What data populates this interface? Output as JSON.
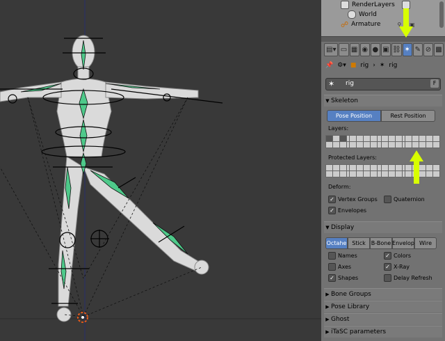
{
  "outliner": {
    "items": [
      {
        "label": "RenderLayers",
        "icon": "render-layers-icon"
      },
      {
        "label": "World",
        "icon": "world-icon"
      },
      {
        "label": "Armature",
        "icon": "armature-icon"
      }
    ]
  },
  "breadcrumb": {
    "object": "rig",
    "data": "rig"
  },
  "name_field": {
    "value": "rig",
    "fake_user": "F"
  },
  "skeleton": {
    "title": "Skeleton",
    "pose_position": "Pose Position",
    "rest_position": "Rest Position",
    "layers_label": "Layers:",
    "protected_label": "Protected Layers:",
    "deform_label": "Deform:",
    "vertex_groups": "Vertex Groups",
    "quaternion": "Quaternion",
    "envelopes": "Envelopes"
  },
  "display": {
    "title": "Display",
    "types": [
      "Octahe",
      "Stick",
      "B-Bone",
      "Envelop",
      "Wire"
    ],
    "active_type": "Octahe",
    "names": "Names",
    "colors": "Colors",
    "axes": "Axes",
    "xray": "X-Ray",
    "shapes": "Shapes",
    "delay_refresh": "Delay Refresh"
  },
  "collapsed_sections": [
    "Bone Groups",
    "Pose Library",
    "Ghost",
    "iTaSC parameters"
  ],
  "colors": {
    "accent_blue": "#5680c2",
    "highlight_arrow": "#d8ff00",
    "bone_green": "#4ec98a"
  }
}
